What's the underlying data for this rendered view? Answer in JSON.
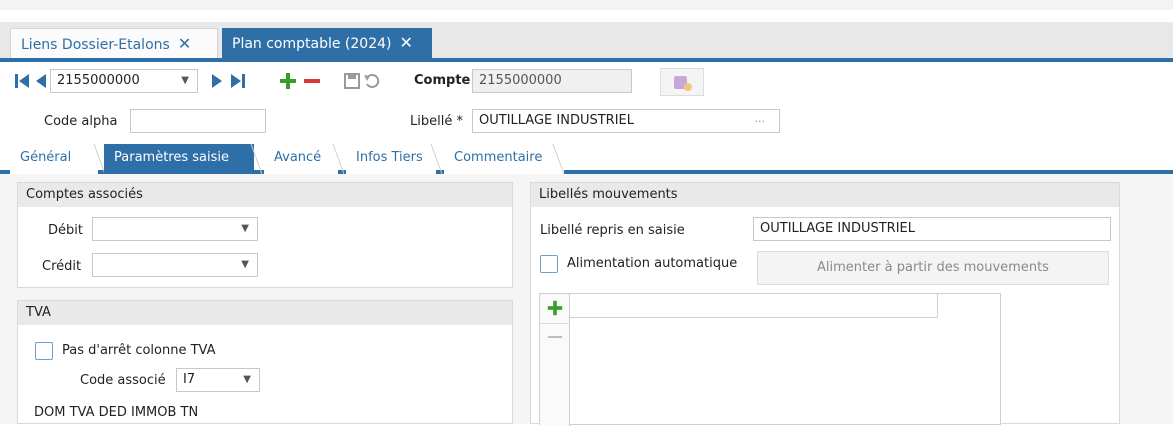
{
  "doc_tabs": [
    {
      "label": "Liens Dossier-Etalons",
      "close": "✕"
    },
    {
      "label": "Plan comptable (2024)",
      "close": "✕"
    }
  ],
  "toolbar": {
    "account_select": "2155000000",
    "compte_label": "Compte",
    "compte_value": "2155000000"
  },
  "fields": {
    "code_alpha_label": "Code alpha",
    "code_alpha_value": "",
    "libelle_label": "Libellé *",
    "libelle_value": "OUTILLAGE INDUSTRIEL",
    "libelle_more": "..."
  },
  "inner_tabs": [
    "Général",
    "Paramètres saisie",
    "Avancé",
    "Infos Tiers",
    "Commentaire"
  ],
  "comptes_associes": {
    "title": "Comptes associés",
    "debit_label": "Débit",
    "debit_value": "",
    "credit_label": "Crédit",
    "credit_value": ""
  },
  "tva": {
    "title": "TVA",
    "pas_arret_label": "Pas d'arrêt colonne TVA",
    "code_associe_label": "Code associé",
    "code_associe_value": "I7",
    "description": "DOM TVA DED IMMOB TN"
  },
  "libelles_mouvements": {
    "title": "Libellés mouvements",
    "repris_label": "Libellé repris en saisie",
    "repris_value": "OUTILLAGE INDUSTRIEL",
    "auto_label": "Alimentation automatique",
    "alimenter_button": "Alimenter à partir des mouvements"
  },
  "colors": {
    "accent": "#2f6fa7",
    "add_green": "#3a9b2e",
    "remove_red": "#d63a3a"
  }
}
